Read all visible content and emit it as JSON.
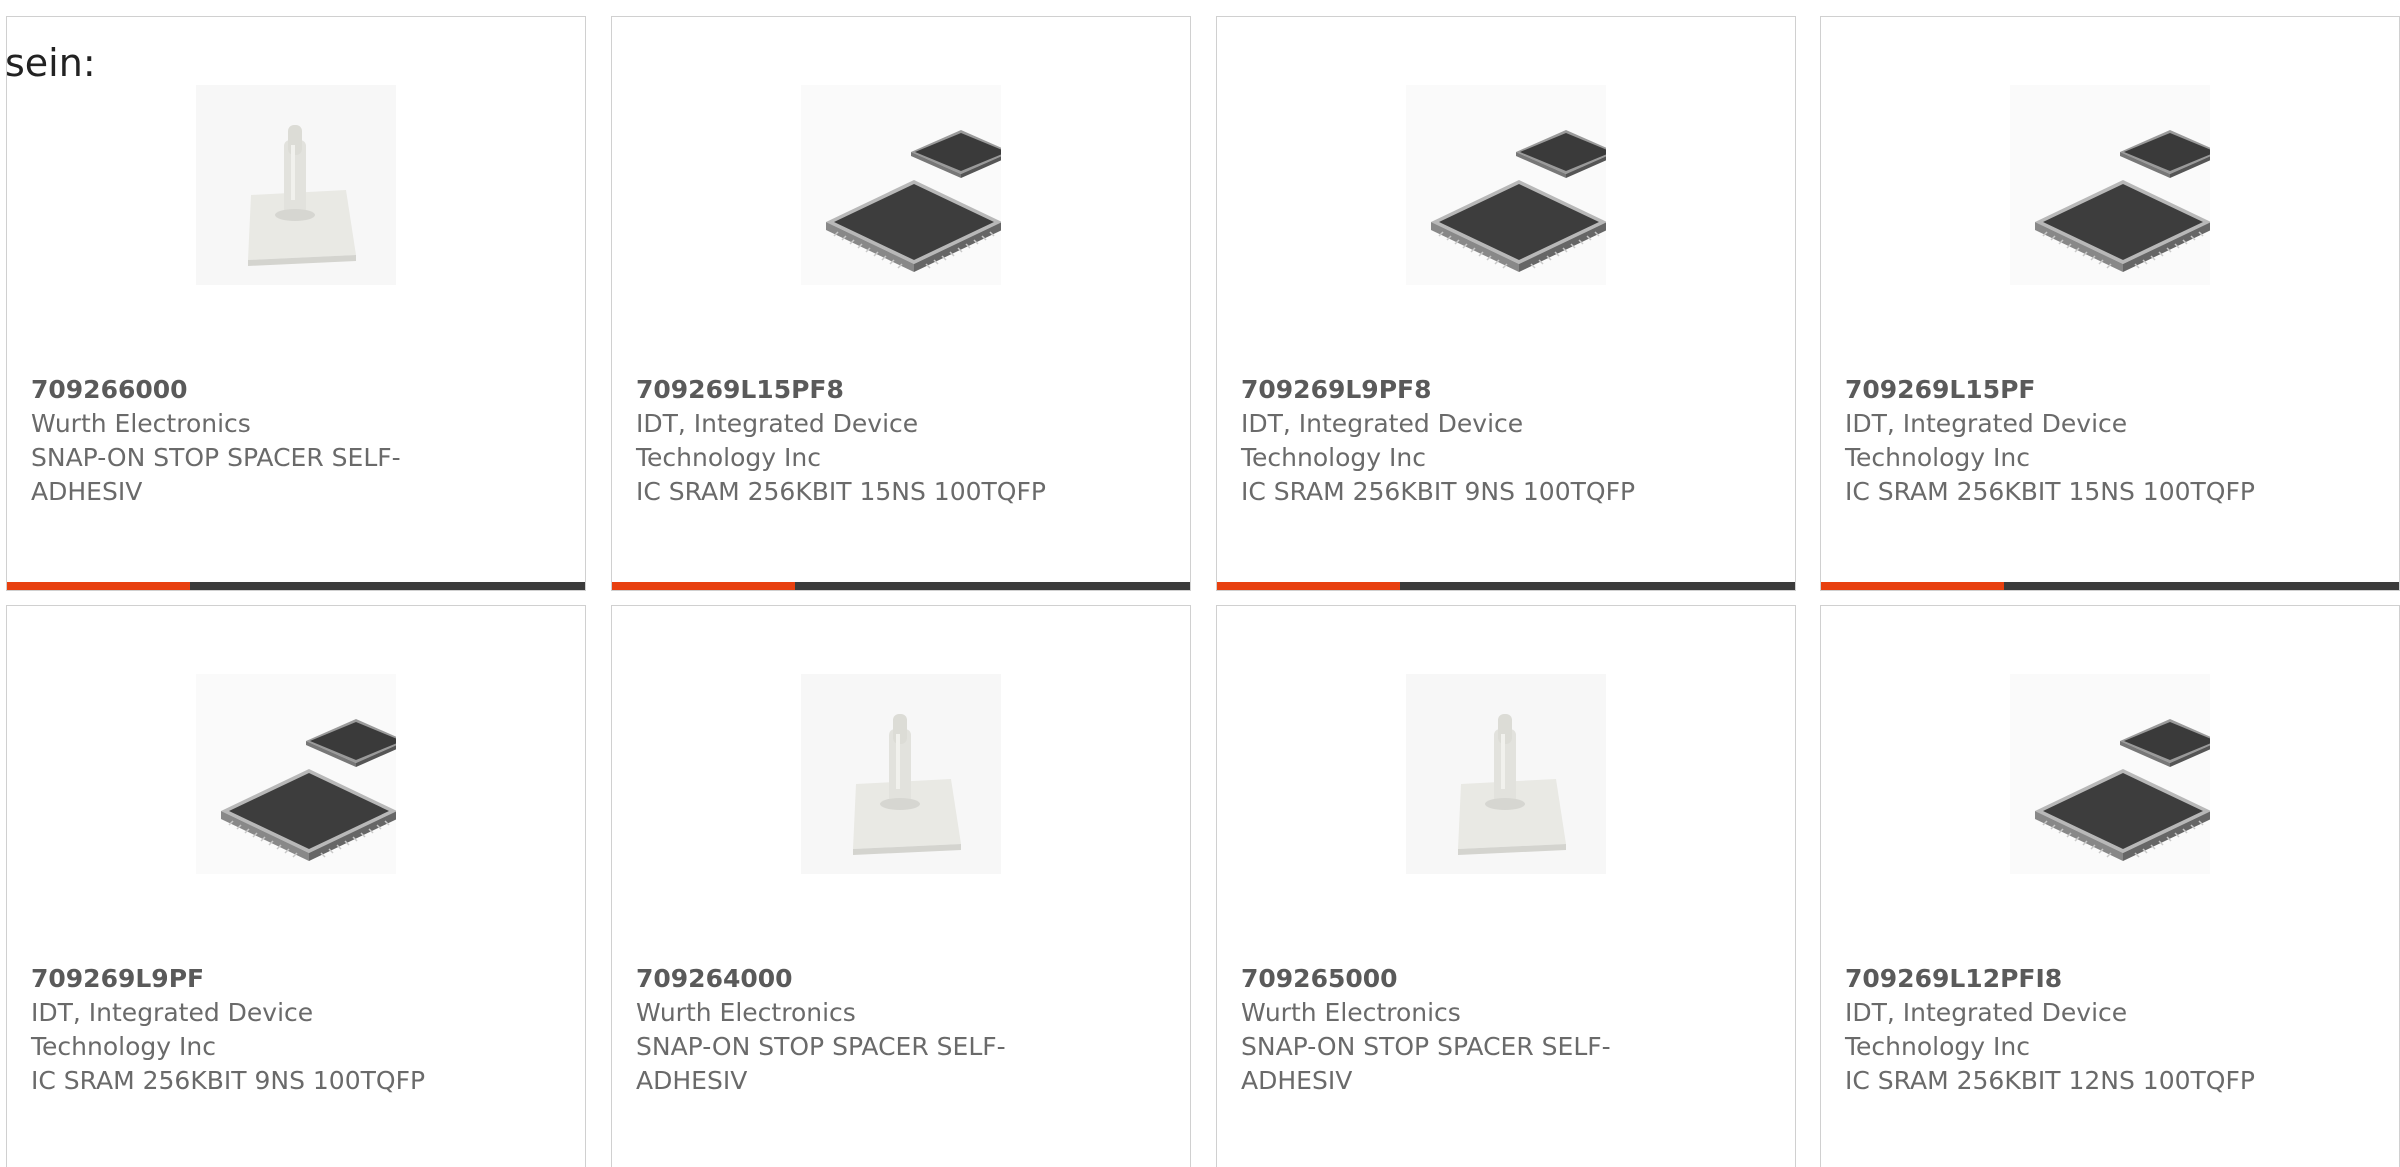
{
  "lead_text": "sein:",
  "colors": {
    "accent": "#e8400f",
    "bar": "#3b3b3b",
    "border": "#d0d0d0",
    "text": "#6a6a6a"
  },
  "cards": [
    {
      "part_number": "709266000",
      "manufacturer": "Wurth Electronics",
      "description": "SNAP-ON STOP SPACER SELF-ADHESIV",
      "image": "spacer-icon"
    },
    {
      "part_number": "709269L15PF8",
      "manufacturer": "IDT, Integrated Device Technology Inc",
      "description": "IC SRAM 256KBIT 15NS 100TQFP",
      "image": "ic-chip-icon"
    },
    {
      "part_number": "709269L9PF8",
      "manufacturer": "IDT, Integrated Device Technology Inc",
      "description": "IC SRAM 256KBIT 9NS 100TQFP",
      "image": "ic-chip-icon"
    },
    {
      "part_number": "709269L15PF",
      "manufacturer": "IDT, Integrated Device Technology Inc",
      "description": "IC SRAM 256KBIT 15NS 100TQFP",
      "image": "ic-chip-icon"
    },
    {
      "part_number": "709269L9PF",
      "manufacturer": "IDT, Integrated Device Technology Inc",
      "description": "IC SRAM 256KBIT 9NS 100TQFP",
      "image": "ic-chip-icon"
    },
    {
      "part_number": "709264000",
      "manufacturer": "Wurth Electronics",
      "description": "SNAP-ON STOP SPACER SELF-ADHESIV",
      "image": "spacer-icon"
    },
    {
      "part_number": "709265000",
      "manufacturer": "Wurth Electronics",
      "description": "SNAP-ON STOP SPACER SELF-ADHESIV",
      "image": "spacer-icon"
    },
    {
      "part_number": "709269L12PFI8",
      "manufacturer": "IDT, Integrated Device Technology Inc",
      "description": "IC SRAM 256KBIT 12NS 100TQFP",
      "image": "ic-chip-icon"
    }
  ]
}
